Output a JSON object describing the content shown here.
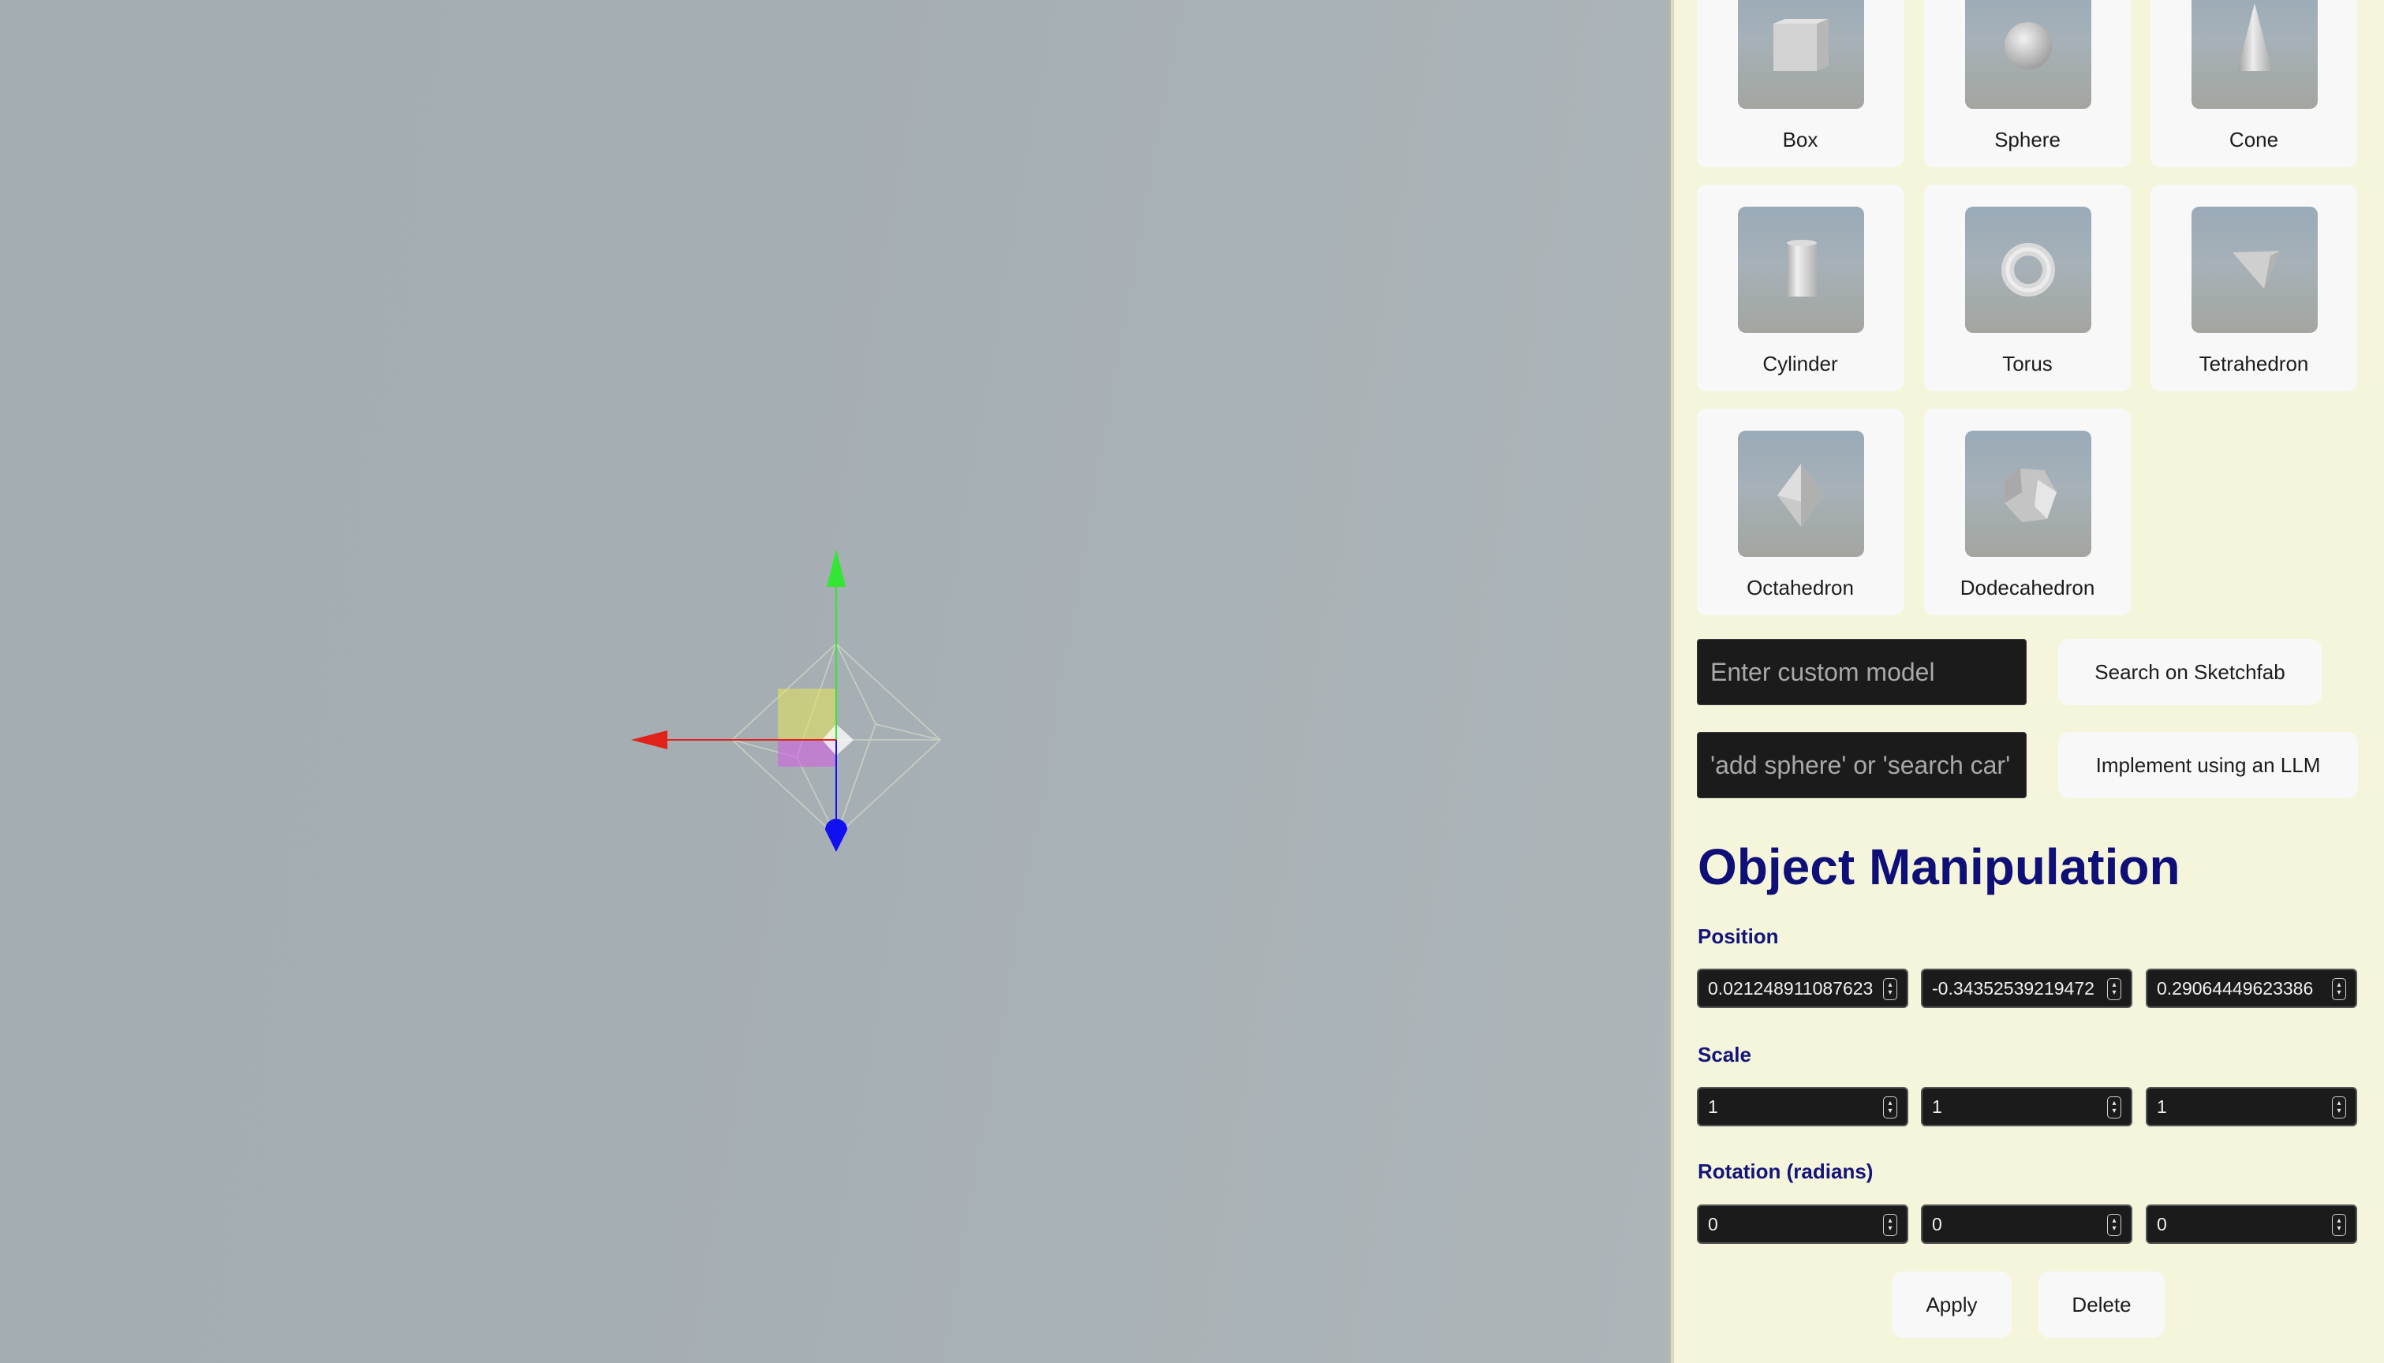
{
  "models": [
    {
      "label": "Box",
      "icon": "box-thumbnail"
    },
    {
      "label": "Sphere",
      "icon": "sphere-thumbnail"
    },
    {
      "label": "Cone",
      "icon": "cone-thumbnail"
    },
    {
      "label": "Cylinder",
      "icon": "cylinder-thumbnail"
    },
    {
      "label": "Torus",
      "icon": "torus-thumbnail"
    },
    {
      "label": "Tetrahedron",
      "icon": "tetrahedron-thumbnail"
    },
    {
      "label": "Octahedron",
      "icon": "octahedron-thumbnail"
    },
    {
      "label": "Dodecahedron",
      "icon": "dodecahedron-thumbnail"
    }
  ],
  "custom_model": {
    "placeholder": "Enter custom model",
    "button": "Search on Sketchfab"
  },
  "command": {
    "placeholder": "'add sphere' or 'search car'",
    "button": "Implement using an LLM"
  },
  "manipulation": {
    "title": "Object Manipulation",
    "position": {
      "label": "Position",
      "x": "0.021248911087623",
      "y": "-0.34352539219472",
      "z": "0.29064449623386"
    },
    "scale": {
      "label": "Scale",
      "x": "1",
      "y": "1",
      "z": "1"
    },
    "rotation": {
      "label": "Rotation (radians)",
      "x": "0",
      "y": "0",
      "z": "0"
    },
    "apply_label": "Apply",
    "delete_label": "Delete"
  },
  "colors": {
    "panel_bg": "#f5f5dc",
    "title": "#0f0f78",
    "axis_x": "#e0231a",
    "axis_y": "#33e633",
    "axis_z": "#1010f0"
  }
}
